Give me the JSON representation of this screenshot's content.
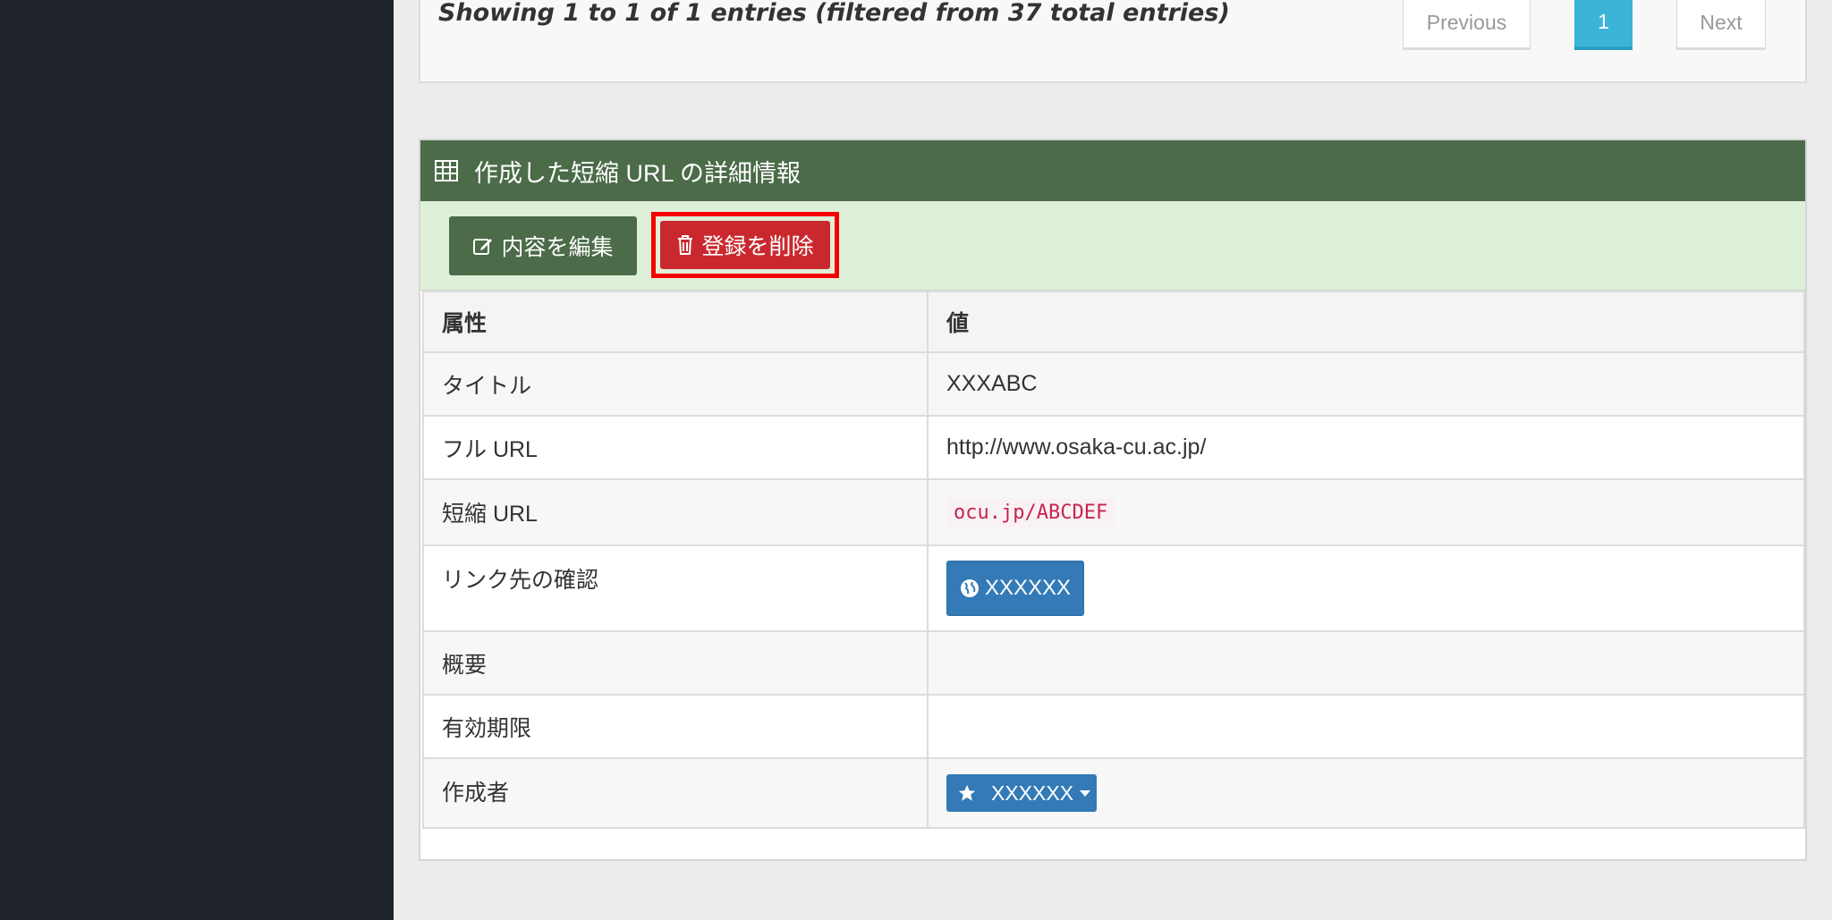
{
  "pagination": {
    "info": "Showing 1 to 1 of 1 entries (filtered from 37 total entries)",
    "previous": "Previous",
    "page": "1",
    "next": "Next"
  },
  "panel": {
    "title": "作成した短縮 URL の詳細情報",
    "edit_button": "内容を編集",
    "delete_button": "登録を削除"
  },
  "table": {
    "headers": {
      "attr": "属性",
      "value": "値"
    },
    "rows": {
      "title": {
        "label": "タイトル",
        "value": "XXXABC"
      },
      "full_url": {
        "label": "フル URL",
        "value": "http://www.osaka-cu.ac.jp/"
      },
      "short_url": {
        "label": "短縮 URL",
        "value": "ocu.jp/ABCDEF"
      },
      "link_check": {
        "label": "リンク先の確認",
        "button": "XXXXXX"
      },
      "summary": {
        "label": "概要",
        "value": ""
      },
      "expiry": {
        "label": "有効期限",
        "value": ""
      },
      "creator": {
        "label": "作成者",
        "button": "XXXXXX"
      }
    }
  },
  "colors": {
    "sidebar": "#1e222a",
    "panel_header": "#4b6b49",
    "delete": "#c9292e",
    "highlight": "#f50000",
    "primary": "#337ab7",
    "page_active": "#3bb4d8"
  }
}
